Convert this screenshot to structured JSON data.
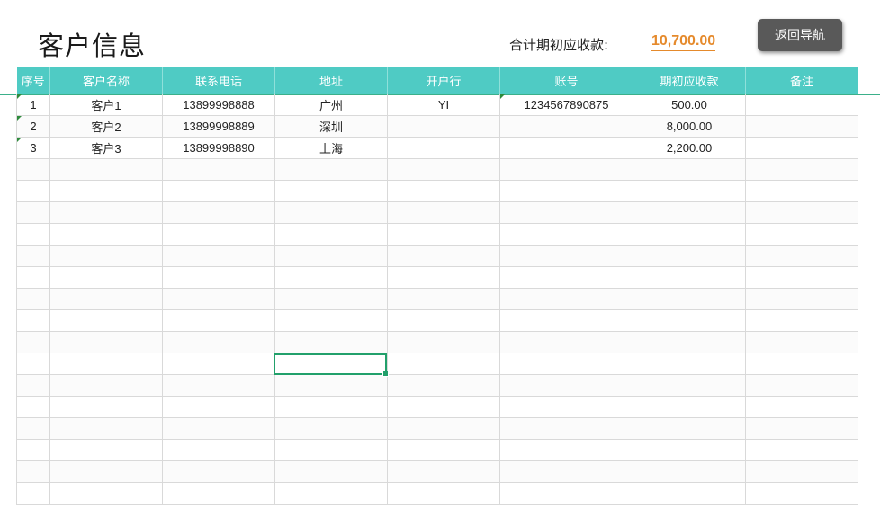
{
  "header": {
    "title": "客户信息",
    "total_label": "合计期初应收款:",
    "total_value": "10,700.00",
    "nav_button_label": "返回导航"
  },
  "table": {
    "columns": [
      "序号",
      "客户名称",
      "联系电话",
      "地址",
      "开户行",
      "账号",
      "期初应收款",
      "备注"
    ],
    "rows": [
      [
        "1",
        "客户1",
        "13899998888",
        "广州",
        "YI",
        "1234567890875",
        "500.00",
        ""
      ],
      [
        "2",
        "客户2",
        "13899998889",
        "深圳",
        "",
        "",
        "8,000.00",
        ""
      ],
      [
        "3",
        "客户3",
        "13899998890",
        "上海",
        "",
        "",
        "2,200.00",
        ""
      ]
    ]
  },
  "colors": {
    "header_bg": "#4fcbc4",
    "accent_total": "#e58a2c",
    "button_bg": "#595959",
    "selection": "#22a06b"
  }
}
